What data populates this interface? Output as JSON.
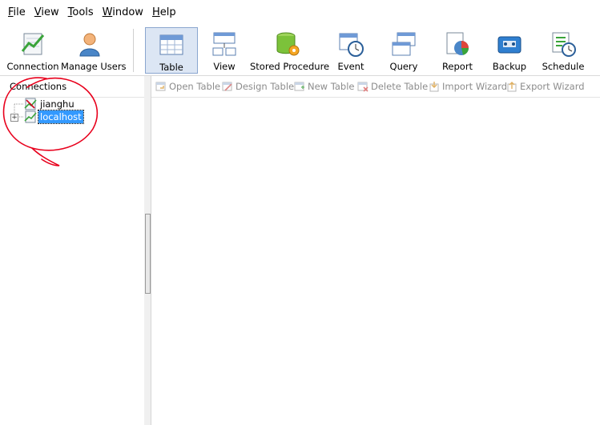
{
  "menu": [
    "File",
    "View",
    "Tools",
    "Window",
    "Help"
  ],
  "toolbar": {
    "connection": "Connection",
    "manage_users": "Manage Users",
    "table": "Table",
    "view": "View",
    "stored_procedure": "Stored Procedure",
    "event": "Event",
    "query": "Query",
    "report": "Report",
    "backup": "Backup",
    "schedule": "Schedule",
    "active": "Table"
  },
  "connections_panel": {
    "header": "Connections",
    "items": [
      {
        "label": "jianghu",
        "selected": false,
        "expandable": false,
        "icon": "connection-broken-icon"
      },
      {
        "label": "localhost",
        "selected": true,
        "expandable": true,
        "expander_symbol": "+",
        "icon": "connection-icon"
      }
    ]
  },
  "object_toolbar": {
    "open_table": "Open Table",
    "design_table": "Design Table",
    "new_table": "New Table",
    "delete_table": "Delete Table",
    "import_wizard": "Import Wizard",
    "export_wizard": "Export Wizard"
  },
  "colors": {
    "selection": "#3399ff",
    "annotation": "#e8001c",
    "active_tool": "#dce6f4"
  }
}
